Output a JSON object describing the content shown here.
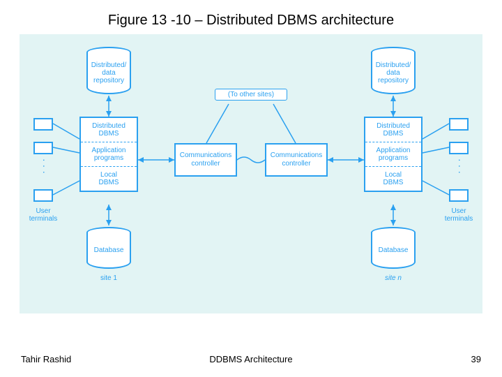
{
  "title": "Figure 13 -10 – Distributed DBMS architecture",
  "footer": {
    "left": "Tahir Rashid",
    "center": "DDBMS Architecture",
    "right": "39"
  },
  "labels": {
    "to_other_sites": "(To other sites)",
    "user_terminals_left": "User\nterminals",
    "user_terminals_right": "User\nterminals",
    "site_left": "site 1",
    "site_right": "site n",
    "database_left": "Database",
    "database_right": "Database",
    "repo": "Distributed/\ndata\nrepository",
    "stack": {
      "ddbms": "Distributed\nDBMS",
      "apps": "Application\nprograms",
      "local": "Local\nDBMS"
    },
    "comm": "Communications\ncontroller"
  }
}
